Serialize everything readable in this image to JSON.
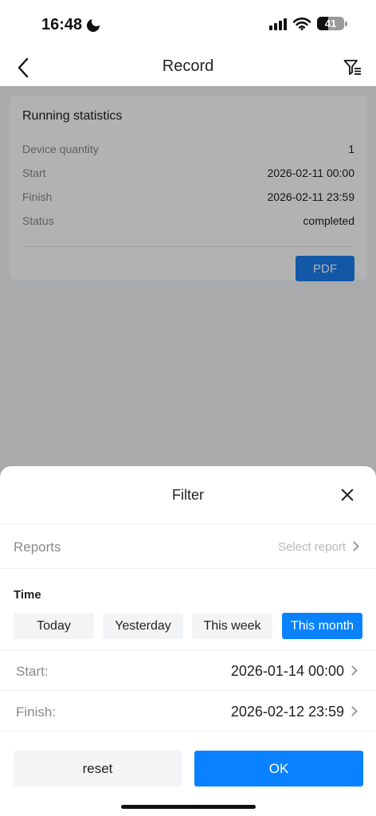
{
  "status_bar": {
    "time": "16:48",
    "battery": "41",
    "battery_level": 0.41
  },
  "nav": {
    "title": "Record",
    "back_icon": "chevron-left-icon",
    "filter_icon": "filter-list-icon"
  },
  "card": {
    "title": "Running statistics",
    "rows": [
      {
        "key": "Device quantity",
        "value": "1"
      },
      {
        "key": "Start",
        "value": "2026-02-11 00:00"
      },
      {
        "key": "Finish",
        "value": "2026-02-11 23:59"
      },
      {
        "key": "Status",
        "value": "completed"
      }
    ],
    "pdf_label": "PDF"
  },
  "filter": {
    "title": "Filter",
    "reports_label": "Reports",
    "reports_placeholder": "Select report",
    "time_label": "Time",
    "chips": [
      {
        "label": "Today",
        "active": false
      },
      {
        "label": "Yesterday",
        "active": false
      },
      {
        "label": "This week",
        "active": false
      },
      {
        "label": "This month",
        "active": true
      }
    ],
    "start_label": "Start:",
    "start_value": "2026-01-14 00:00",
    "finish_label": "Finish:",
    "finish_value": "2026-02-12 23:59",
    "reset_label": "reset",
    "ok_label": "OK"
  },
  "colors": {
    "accent": "#0a82ff",
    "pdf_button": "#1a7ff0"
  }
}
